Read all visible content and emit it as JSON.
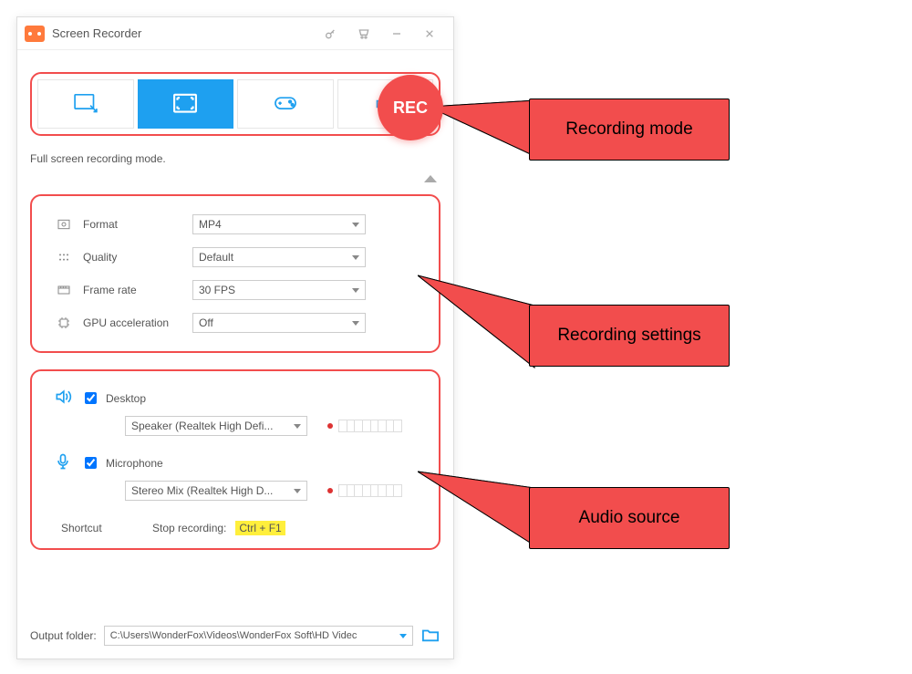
{
  "titlebar": {
    "title": "Screen Recorder"
  },
  "rec_label": "REC",
  "hint": "Full screen recording mode.",
  "settings": {
    "format": {
      "label": "Format",
      "value": "MP4"
    },
    "quality": {
      "label": "Quality",
      "value": "Default"
    },
    "framerate": {
      "label": "Frame rate",
      "value": "30 FPS"
    },
    "gpu": {
      "label": "GPU acceleration",
      "value": "Off"
    }
  },
  "audio": {
    "desktop": {
      "label": "Desktop",
      "device": "Speaker (Realtek High Defi...",
      "checked": true
    },
    "mic": {
      "label": "Microphone",
      "device": "Stereo Mix (Realtek High D...",
      "checked": true
    }
  },
  "shortcut": {
    "label": "Shortcut",
    "stop_label": "Stop recording:",
    "key": "Ctrl + F1"
  },
  "output": {
    "label": "Output folder:",
    "path": "C:\\Users\\WonderFox\\Videos\\WonderFox Soft\\HD Videc"
  },
  "callouts": {
    "mode": "Recording mode",
    "settings": "Recording settings",
    "audio": "Audio source"
  }
}
